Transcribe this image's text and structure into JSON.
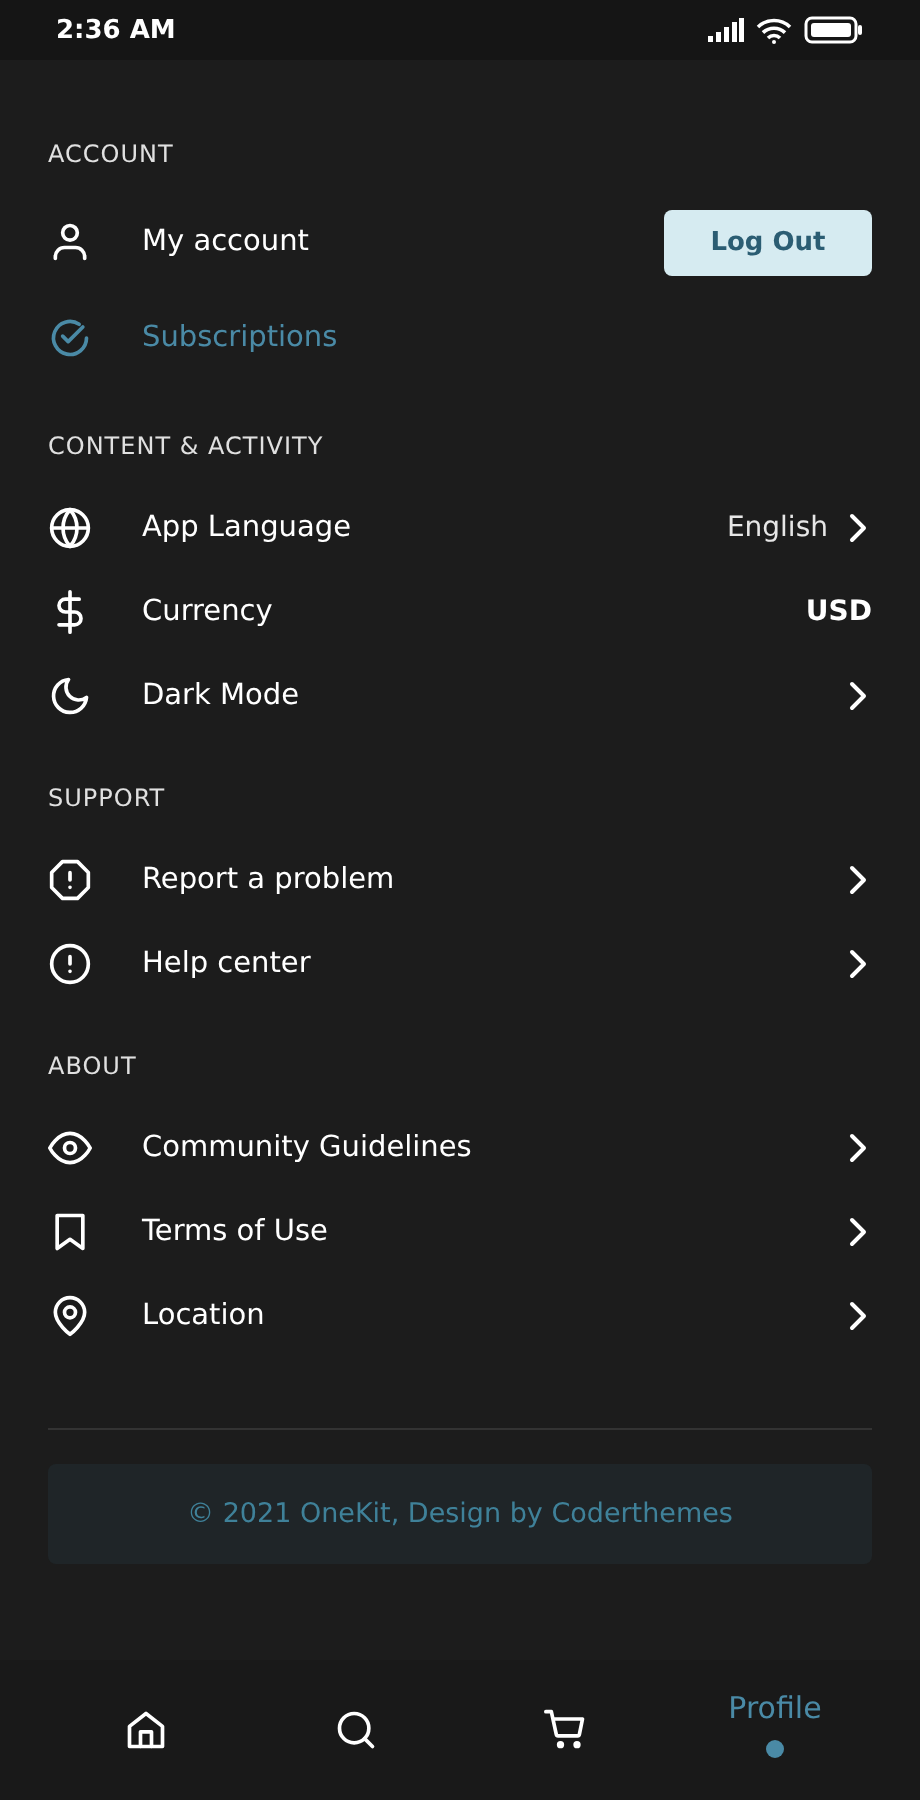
{
  "status_bar": {
    "time": "2:36 AM"
  },
  "sections": [
    {
      "title": "ACCOUNT",
      "items": [
        {
          "label": "My account",
          "selected": false,
          "chevron": false,
          "action": "Log Out"
        },
        {
          "label": "Subscriptions",
          "selected": true,
          "chevron": false
        }
      ]
    },
    {
      "title": "CONTENT & ACTIVITY",
      "items": [
        {
          "label": "App Language",
          "selected": false,
          "chevron": true,
          "value": "English"
        },
        {
          "label": "Currency",
          "selected": false,
          "chevron": false,
          "value": "USD"
        },
        {
          "label": "Dark Mode",
          "selected": false,
          "chevron": true
        }
      ]
    },
    {
      "title": "SUPPORT",
      "items": [
        {
          "label": "Report a problem",
          "selected": false,
          "chevron": true
        },
        {
          "label": "Help center",
          "selected": false,
          "chevron": true
        }
      ]
    },
    {
      "title": "ABOUT",
      "items": [
        {
          "label": "Community Guidelines",
          "selected": false,
          "chevron": true
        },
        {
          "label": "Terms of Use",
          "selected": false,
          "chevron": true
        },
        {
          "label": "Location",
          "selected": false,
          "chevron": true
        }
      ]
    }
  ],
  "footer": "© 2021 OneKit, Design by Coderthemes",
  "nav": [
    {
      "selected": false
    },
    {
      "selected": false
    },
    {
      "selected": false
    },
    {
      "label": "Profile",
      "selected": true
    }
  ]
}
